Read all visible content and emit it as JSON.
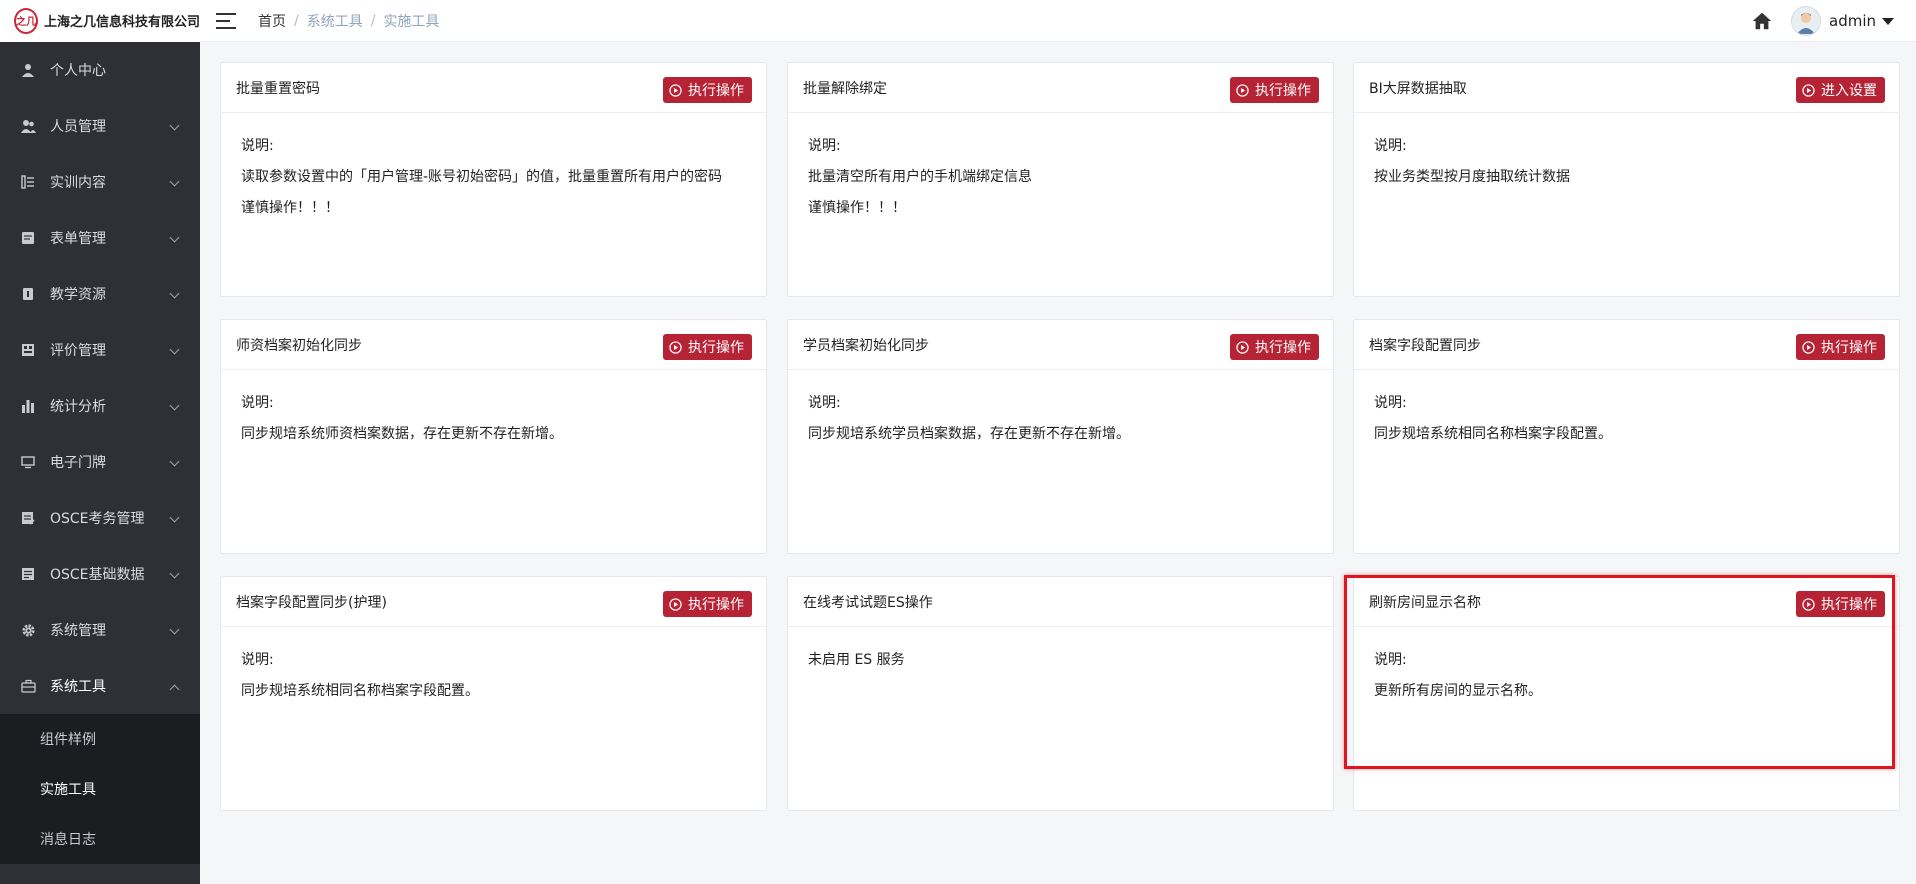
{
  "header": {
    "logo_mark": "之几",
    "company": "上海之几信息科技有限公司",
    "breadcrumb": [
      "首页",
      "系统工具",
      "实施工具"
    ],
    "username": "admin"
  },
  "sidebar": {
    "items": [
      {
        "label": "个人中心"
      },
      {
        "label": "人员管理"
      },
      {
        "label": "实训内容"
      },
      {
        "label": "表单管理"
      },
      {
        "label": "教学资源"
      },
      {
        "label": "评价管理"
      },
      {
        "label": "统计分析"
      },
      {
        "label": "电子门牌"
      },
      {
        "label": "OSCE考务管理"
      },
      {
        "label": "OSCE基础数据"
      },
      {
        "label": "系统管理"
      },
      {
        "label": "系统工具"
      }
    ],
    "submenu": [
      {
        "label": "组件样例"
      },
      {
        "label": "实施工具"
      },
      {
        "label": "消息日志"
      }
    ]
  },
  "cards": [
    {
      "title": "批量重置密码",
      "button": "执行操作",
      "lines": [
        "说明:",
        "读取参数设置中的「用户管理-账号初始密码」的值，批量重置所有用户的密码",
        "谨慎操作！！！"
      ]
    },
    {
      "title": "批量解除绑定",
      "button": "执行操作",
      "lines": [
        "说明:",
        "批量清空所有用户的手机端绑定信息",
        "谨慎操作！！！"
      ]
    },
    {
      "title": "BI大屏数据抽取",
      "button": "进入设置",
      "lines": [
        "说明:",
        "按业务类型按月度抽取统计数据"
      ]
    },
    {
      "title": "师资档案初始化同步",
      "button": "执行操作",
      "lines": [
        "说明:",
        "同步规培系统师资档案数据，存在更新不存在新增。"
      ]
    },
    {
      "title": "学员档案初始化同步",
      "button": "执行操作",
      "lines": [
        "说明:",
        "同步规培系统学员档案数据，存在更新不存在新增。"
      ]
    },
    {
      "title": "档案字段配置同步",
      "button": "执行操作",
      "lines": [
        "说明:",
        "同步规培系统相同名称档案字段配置。"
      ]
    },
    {
      "title": "档案字段配置同步(护理)",
      "button": "执行操作",
      "lines": [
        "说明:",
        "同步规培系统相同名称档案字段配置。"
      ]
    },
    {
      "title": "在线考试试题ES操作",
      "button": "",
      "lines": [
        "未启用 ES 服务"
      ]
    },
    {
      "title": "刷新房间显示名称",
      "button": "执行操作",
      "lines": [
        "说明:",
        "更新所有房间的显示名称。"
      ]
    }
  ],
  "colors": {
    "accent": "#b52335",
    "sidebar_bg": "#2e3035",
    "highlight": "#e0161e"
  }
}
